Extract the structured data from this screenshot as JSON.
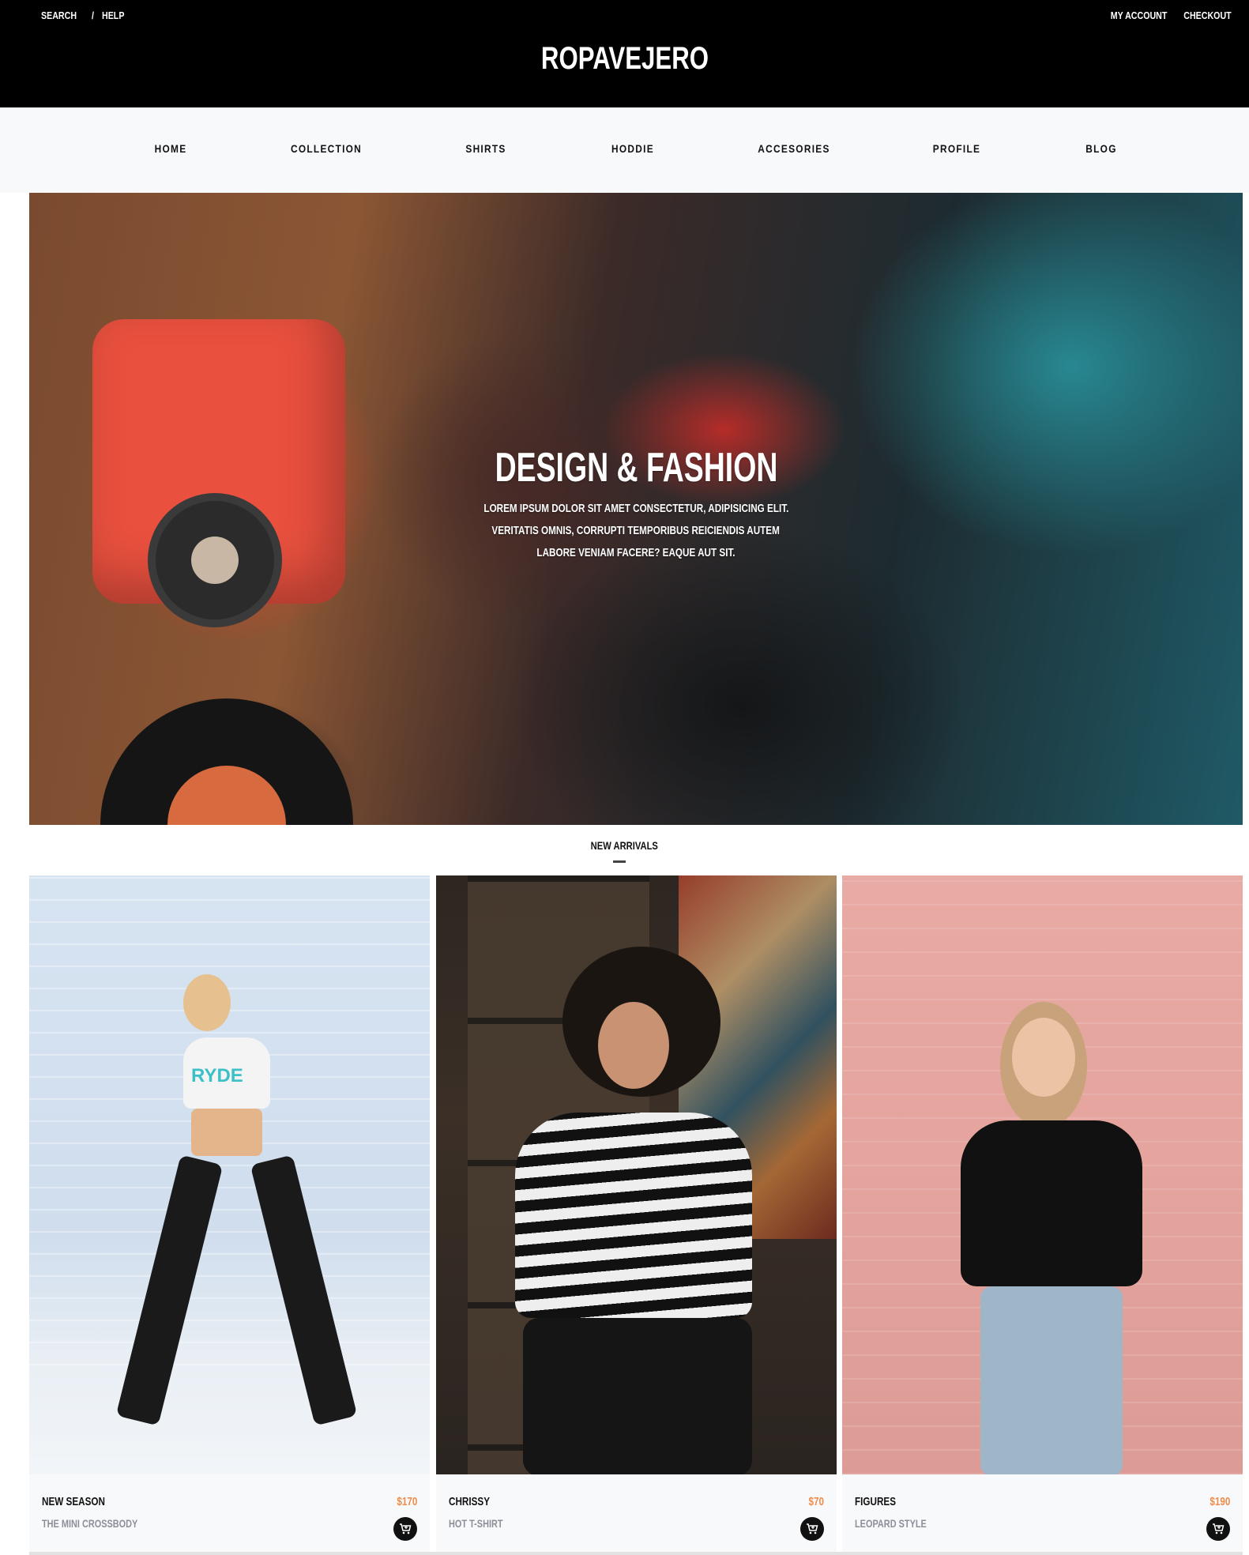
{
  "topbar": {
    "left_links": [
      "SEARCH",
      "/",
      "HELP"
    ],
    "right_links": [
      "MY ACCOUNT",
      "CHECKOUT"
    ],
    "brand": "ROPAVEJERO"
  },
  "nav": {
    "items": [
      "HOME",
      "COLLECTION",
      "SHIRTS",
      "HODDIE",
      "ACCESORIES",
      "PROFILE",
      "BLOG"
    ]
  },
  "hero": {
    "title": "DESIGN & FASHION",
    "subtitle_lines": [
      "LOREM IPSUM DOLOR SIT AMET CONSECTETUR, ADIPISICING ELIT.",
      "VERITATIS OMNIS, CORRUPTI TEMPORIBUS REICIENDIS AUTEM",
      "LABORE VENIAM FACERE? EAQUE AUT SIT."
    ]
  },
  "new_arrivals": {
    "title": "NEW ARRIVALS",
    "products": [
      {
        "name": "NEW SEASON",
        "subtitle": "THE MINI CROSSBODY",
        "price": "$170",
        "shirt_text": "RYDE"
      },
      {
        "name": "CHRISSY",
        "subtitle": "HOT T-SHIRT",
        "price": "$70"
      },
      {
        "name": "FIGURES",
        "subtitle": "LEOPARD STYLE",
        "price": "$190"
      }
    ]
  },
  "colors": {
    "topbar_bg": "#000000",
    "nav_bg": "#f8f9fb",
    "price": "#f08c4a",
    "subtitle": "#8a8f98"
  },
  "icons": [
    "cart-icon"
  ]
}
